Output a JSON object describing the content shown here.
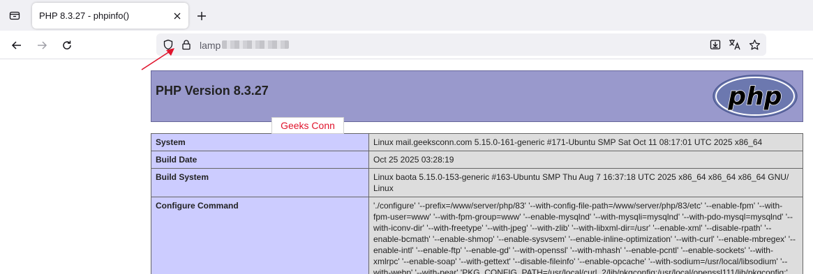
{
  "browser": {
    "tab_title": "PHP 8.3.27 - phpinfo()",
    "url_visible": "lamp",
    "icons": [
      "tabs-list-icon",
      "close-icon",
      "plus-icon",
      "back-arrow-icon",
      "forward-arrow-icon",
      "reload-icon",
      "shield-icon",
      "lock-icon",
      "download-icon",
      "translate-icon",
      "star-icon"
    ]
  },
  "php": {
    "version_title": "PHP Version 8.3.27",
    "logo_text": "php"
  },
  "watermark": "Geeks Conn",
  "rows": [
    {
      "key": "System",
      "value": "Linux mail.geeksconn.com 5.15.0-161-generic #171-Ubuntu SMP Sat Oct 11 08:17:01 UTC 2025 x86_64"
    },
    {
      "key": "Build Date",
      "value": "Oct 25 2025 03:28:19"
    },
    {
      "key": "Build System",
      "value": "Linux baota 5.15.0-153-generic #163-Ubuntu SMP Thu Aug 7 16:37:18 UTC 2025 x86_64 x86_64 x86_64 GNU/ Linux"
    },
    {
      "key": "Configure Command",
      "value": "'./configure' '--prefix=/www/server/php/83' '--with-config-file-path=/www/server/php/83/etc' '--enable-fpm' '--with-fpm-user=www' '--with-fpm-group=www' '--enable-mysqlnd' '--with-mysqli=mysqlnd' '--with-pdo-mysql=mysqlnd' '--with-iconv-dir' '--with-freetype' '--with-jpeg' '--with-zlib' '--with-libxml-dir=/usr' '--enable-xml' '--disable-rpath' '--enable-bcmath' '--enable-shmop' '--enable-sysvsem' '--enable-inline-optimization' '--with-curl' '--enable-mbregex' '--enable-intl' '--enable-ftp' '--enable-gd' '--with-openssl' '--with-mhash' '--enable-pcntl' '--enable-sockets' '--with-xmlrpc' '--enable-soap' '--with-gettext' '--disable-fileinfo' '--enable-opcache' '--with-sodium=/usr/local/libsodium' '--with-webp' '--with-pear' 'PKG_CONFIG_PATH=/usr/local/curl_2/lib/pkgconfig:/usr/local/openssl111/lib/pkgconfig:'"
    }
  ],
  "colors": {
    "header_bg": "#9999cc",
    "key_cell_bg": "#ccccff",
    "value_cell_bg": "#dddddd",
    "annotation_red": "#e0142c"
  }
}
